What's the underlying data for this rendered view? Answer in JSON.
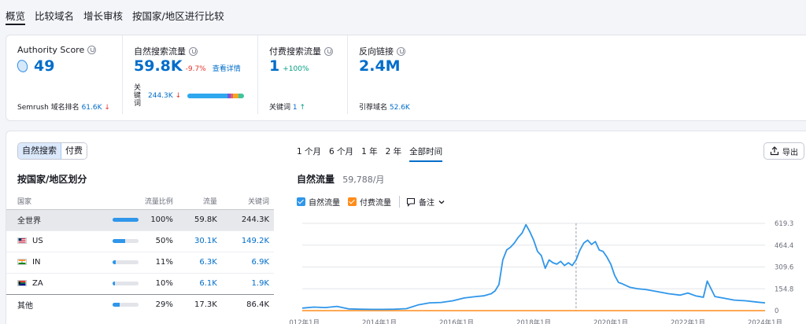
{
  "tabs": [
    "概览",
    "比较域名",
    "增长审核",
    "按国家/地区进行比较"
  ],
  "metrics": {
    "authority": {
      "label": "Authority Score",
      "value": "49",
      "foot_label": "Semrush 域名排名",
      "foot_value": "61.6K"
    },
    "organic": {
      "label": "自然搜索流量",
      "value": "59.8K",
      "delta": "-9.7%",
      "link": "查看详情",
      "kw_label": "关键词",
      "kw_value": "244.3K"
    },
    "paid": {
      "label": "付费搜索流量",
      "value": "1",
      "delta": "+100%",
      "foot_label": "关键词",
      "foot_value": "1"
    },
    "backlinks": {
      "label": "反向链接",
      "value": "2.4M",
      "foot_label": "引荐域名",
      "foot_value": "52.6K"
    }
  },
  "kw_bar_segments": [
    {
      "share": 0.7,
      "color": "#2ea7ef"
    },
    {
      "share": 0.06,
      "color": "#7b57d6"
    },
    {
      "share": 0.04,
      "color": "#e85b7a"
    },
    {
      "share": 0.1,
      "color": "#f5a623"
    },
    {
      "share": 0.1,
      "color": "#3fc59d"
    }
  ],
  "segment": {
    "organic": "自然搜索",
    "paid": "付费"
  },
  "country_section": {
    "title": "按国家/地区划分",
    "headers": [
      "国家",
      "流量比例",
      "流量",
      "关键词"
    ],
    "rows": [
      {
        "name": "全世界",
        "share": "100%",
        "share_num": 1.0,
        "traffic": "59.8K",
        "keywords": "244.3K",
        "flag": "",
        "highlight": true,
        "linked": false
      },
      {
        "name": "US",
        "share": "50%",
        "share_num": 0.5,
        "traffic": "30.1K",
        "keywords": "149.2K",
        "flag": "us",
        "highlight": false,
        "linked": true
      },
      {
        "name": "IN",
        "share": "11%",
        "share_num": 0.11,
        "traffic": "6.3K",
        "keywords": "6.9K",
        "flag": "in",
        "highlight": false,
        "linked": true
      },
      {
        "name": "ZA",
        "share": "10%",
        "share_num": 0.1,
        "traffic": "6.1K",
        "keywords": "1.9K",
        "flag": "za",
        "highlight": false,
        "linked": true
      },
      {
        "name": "其他",
        "share": "29%",
        "share_num": 0.29,
        "traffic": "17.3K",
        "keywords": "86.4K",
        "flag": "",
        "highlight": false,
        "linked": false,
        "other": true
      }
    ]
  },
  "time_ranges": [
    "1 个月",
    "6 个月",
    "1 年",
    "2 年",
    "全部时间"
  ],
  "active_range": "全部时间",
  "export_label": "导出",
  "chart_header": {
    "title": "自然流量",
    "value": "59,788/月"
  },
  "legend": {
    "organic": "自然流量",
    "paid": "付费流量",
    "notes": "备注"
  },
  "colors": {
    "accent": "#006dca",
    "organic": "#2f96ea",
    "paid": "#ff8c1a"
  },
  "chart_data": {
    "type": "line",
    "title": "自然流量",
    "x_ticks": [
      "2012年1月",
      "2014年1月",
      "2016年1月",
      "2018年1月",
      "2020年1月",
      "2022年1月",
      "2024年1月"
    ],
    "y_ticks": [
      "619.3K",
      "464.4K",
      "309.6K",
      "154.8K",
      "0"
    ],
    "ylim": [
      0,
      619300
    ],
    "xlim": [
      2012.0,
      2024.0
    ],
    "grid": true,
    "series": [
      {
        "name": "自然流量",
        "x": [
          2012.0,
          2012.3,
          2012.6,
          2012.9,
          2013.2,
          2013.5,
          2013.8,
          2014.1,
          2014.4,
          2014.7,
          2015.0,
          2015.3,
          2015.6,
          2015.9,
          2016.2,
          2016.5,
          2016.7,
          2016.9,
          2017.0,
          2017.1,
          2017.2,
          2017.3,
          2017.4,
          2017.5,
          2017.6,
          2017.7,
          2017.8,
          2017.9,
          2018.0,
          2018.1,
          2018.2,
          2018.3,
          2018.4,
          2018.5,
          2018.6,
          2018.7,
          2018.8,
          2018.9,
          2019.0,
          2019.1,
          2019.2,
          2019.3,
          2019.4,
          2019.5,
          2019.6,
          2019.7,
          2019.8,
          2019.9,
          2020.0,
          2020.1,
          2020.2,
          2020.3,
          2020.5,
          2020.7,
          2020.9,
          2021.2,
          2021.5,
          2021.8,
          2022.0,
          2022.2,
          2022.4,
          2022.5,
          2022.7,
          2022.9,
          2023.2,
          2023.5,
          2023.8,
          2024.0
        ],
        "y": [
          18000,
          25000,
          22000,
          30000,
          12000,
          10000,
          9000,
          9000,
          10000,
          14000,
          40000,
          55000,
          58000,
          70000,
          90000,
          100000,
          105000,
          120000,
          140000,
          185000,
          360000,
          430000,
          450000,
          480000,
          520000,
          550000,
          610000,
          560000,
          500000,
          420000,
          390000,
          300000,
          360000,
          340000,
          330000,
          350000,
          320000,
          340000,
          320000,
          360000,
          430000,
          480000,
          500000,
          470000,
          490000,
          430000,
          420000,
          380000,
          330000,
          250000,
          200000,
          190000,
          165000,
          155000,
          150000,
          135000,
          120000,
          110000,
          125000,
          105000,
          95000,
          210000,
          100000,
          90000,
          75000,
          70000,
          60000,
          55000
        ]
      },
      {
        "name": "付费流量",
        "x": [
          2012.0,
          2024.0
        ],
        "y": [
          0,
          0
        ]
      }
    ],
    "annotation_x": 2019.1
  }
}
